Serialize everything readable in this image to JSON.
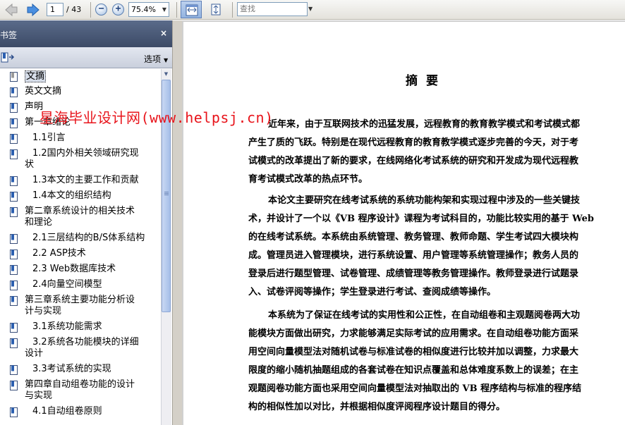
{
  "toolbar": {
    "back_icon": "back-arrow-icon",
    "forward_icon": "forward-arrow-icon",
    "current_page": "1",
    "total_pages": "/ 43",
    "zoom_out_symbol": "−",
    "zoom_in_symbol": "+",
    "zoom_level": "75.4%",
    "search_placeholder": "查找",
    "dropdown_glyph": "▼"
  },
  "panel": {
    "title": "书签",
    "close_glyph": "×",
    "options_label": "选项",
    "items": [
      {
        "label": "文摘",
        "level": 0,
        "selected": true
      },
      {
        "label": "英文文摘",
        "level": 0
      },
      {
        "label": "声明",
        "level": 0
      },
      {
        "label": "第一章绪论",
        "level": 0
      },
      {
        "label": "1.1引言",
        "level": 1
      },
      {
        "label": "1.2国内外相关领域研究现",
        "label2": "状",
        "level": 1
      },
      {
        "label": "1.3本文的主要工作和贡献",
        "level": 1
      },
      {
        "label": "1.4本文的组织结构",
        "level": 1
      },
      {
        "label": "第二章系统设计的相关技术",
        "label2": "和理论",
        "level": 0
      },
      {
        "label": "2.1三层结构的B/S体系结构",
        "level": 1
      },
      {
        "label": "2.2 ASP技术",
        "level": 1
      },
      {
        "label": "2.3 Web数据库技术",
        "level": 1
      },
      {
        "label": "2.4向量空间模型",
        "level": 1
      },
      {
        "label": "第三章系统主要功能分析设",
        "label2": "计与实现",
        "level": 0
      },
      {
        "label": "3.1系统功能需求",
        "level": 1
      },
      {
        "label": "3.2系统各功能模块的详细",
        "label2": "设计",
        "level": 1
      },
      {
        "label": "3.3考试系统的实现",
        "level": 1
      },
      {
        "label": "第四章自动组卷功能的设计",
        "label2": "与实现",
        "level": 0
      },
      {
        "label": "4.1自动组卷原则",
        "level": 1
      }
    ]
  },
  "document": {
    "title": "摘要",
    "paragraphs": [
      [
        "近年来，由于互联网技术的迅猛发展，远程教育的教育教学模式和考试模式都",
        "产生了质的飞跃。特别是在现代远程教育的教育教学模式逐步完善的今天，对于考",
        "试模式的改革提出了新的要求，在线网络化考试系统的研究和开发成为现代远程教",
        "育考试模式改革的热点环节。"
      ],
      [
        "本论文主要研究在线考试系统的系统功能构架和实现过程中涉及的一些关键技",
        "术，并设计了一个以《VB 程序设计》课程为考试科目的，功能比较实用的基于 Web",
        "的在线考试系统。本系统由系统管理、教务管理、教师命题、学生考试四大模块构",
        "成。管理员进入管理模块，进行系统设置、用户管理等系统管理操作；教务人员的",
        "登录后进行题型管理、试卷管理、成绩管理等教务管理操作。教师登录进行试题录",
        "入、试卷评阅等操作；学生登录进行考试、查阅成绩等操作。"
      ],
      [
        "本系统为了保证在线考试的实用性和公正性，在自动组卷和主观题阅卷两大功",
        "能模块方面做出研究，力求能够满足实际考试的应用需求。在自动组卷功能方面采",
        "用空间向量模型法对随机试卷与标准试卷的相似度进行比较并加以调整，力求最大",
        "限度的缩小随机抽题组成的各套试卷在知识点覆盖和总体难度系数上的误差；在主",
        "观题阅卷功能方面也采用空间向量模型法对抽取出的 VB 程序结构与标准的程序结",
        "构的相似性加以对比，并根据相似度评阅程序设计题目的得分。"
      ]
    ]
  },
  "watermark": "星海毕业设计网(www.helpsj.cn)",
  "colors": {
    "watermark": "#e8141b",
    "panel_header": "#4a5a78",
    "selection": "#d6dde9"
  }
}
